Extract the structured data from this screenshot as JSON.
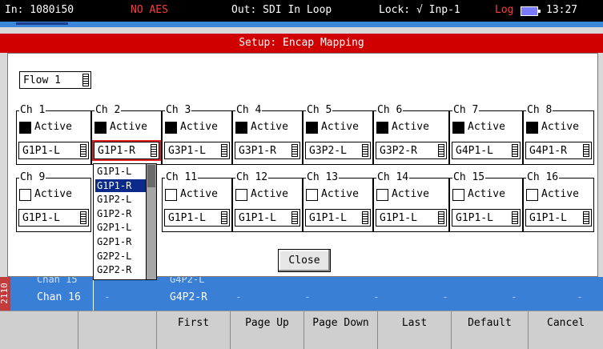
{
  "status": {
    "input": "In: 1080i50",
    "alarm": "NO AES",
    "output": "Out: SDI In Loop",
    "lock": "Lock: √ Inp-1",
    "log": "Log",
    "time": "13:27"
  },
  "dialog": {
    "title": "Setup: Encap Mapping",
    "flow_value": "Flow 1",
    "active_label": "Active",
    "close_label": "Close",
    "channels": [
      {
        "name": "Ch 1",
        "active": true,
        "mapping": "G1P1-L"
      },
      {
        "name": "Ch 2",
        "active": true,
        "mapping": "G1P1-R"
      },
      {
        "name": "Ch 3",
        "active": true,
        "mapping": "G3P1-L"
      },
      {
        "name": "Ch 4",
        "active": true,
        "mapping": "G3P1-R"
      },
      {
        "name": "Ch 5",
        "active": true,
        "mapping": "G3P2-L"
      },
      {
        "name": "Ch 6",
        "active": true,
        "mapping": "G3P2-R"
      },
      {
        "name": "Ch 7",
        "active": true,
        "mapping": "G4P1-L"
      },
      {
        "name": "Ch 8",
        "active": true,
        "mapping": "G4P1-R"
      },
      {
        "name": "Ch 9",
        "active": false,
        "mapping": "G1P1-L"
      },
      {
        "name": "Ch 11",
        "active": false,
        "mapping": "G1P1-L"
      },
      {
        "name": "Ch 12",
        "active": false,
        "mapping": "G1P1-L"
      },
      {
        "name": "Ch 13",
        "active": false,
        "mapping": "G1P1-L"
      },
      {
        "name": "Ch 14",
        "active": false,
        "mapping": "G1P1-L"
      },
      {
        "name": "Ch 15",
        "active": false,
        "mapping": "G1P1-L"
      },
      {
        "name": "Ch 16",
        "active": false,
        "mapping": "G1P1-L"
      }
    ],
    "open_list": {
      "options": [
        "G1P1-L",
        "G1P1-R",
        "G1P2-L",
        "G1P2-R",
        "G2P1-L",
        "G2P1-R",
        "G2P2-L",
        "G2P2-R"
      ],
      "highlighted": "G1P1-R"
    }
  },
  "background": {
    "side_label": "2110",
    "row_prev_label": "Chan 15",
    "row_label": "Chan 16",
    "row_prev_value": "G4P2-L",
    "row_value": "G4P2-R",
    "dash": "-"
  },
  "softkeys": [
    "",
    "",
    "First",
    "Page Up",
    "Page Down",
    "Last",
    "Default",
    "Cancel"
  ],
  "colors": {
    "title_bar": "#d10000",
    "selection_outline": "#e02020",
    "list_highlight": "#0b2a8a",
    "background_rows": "#3a7fd6",
    "alarm_text": "#ff3b3b"
  }
}
